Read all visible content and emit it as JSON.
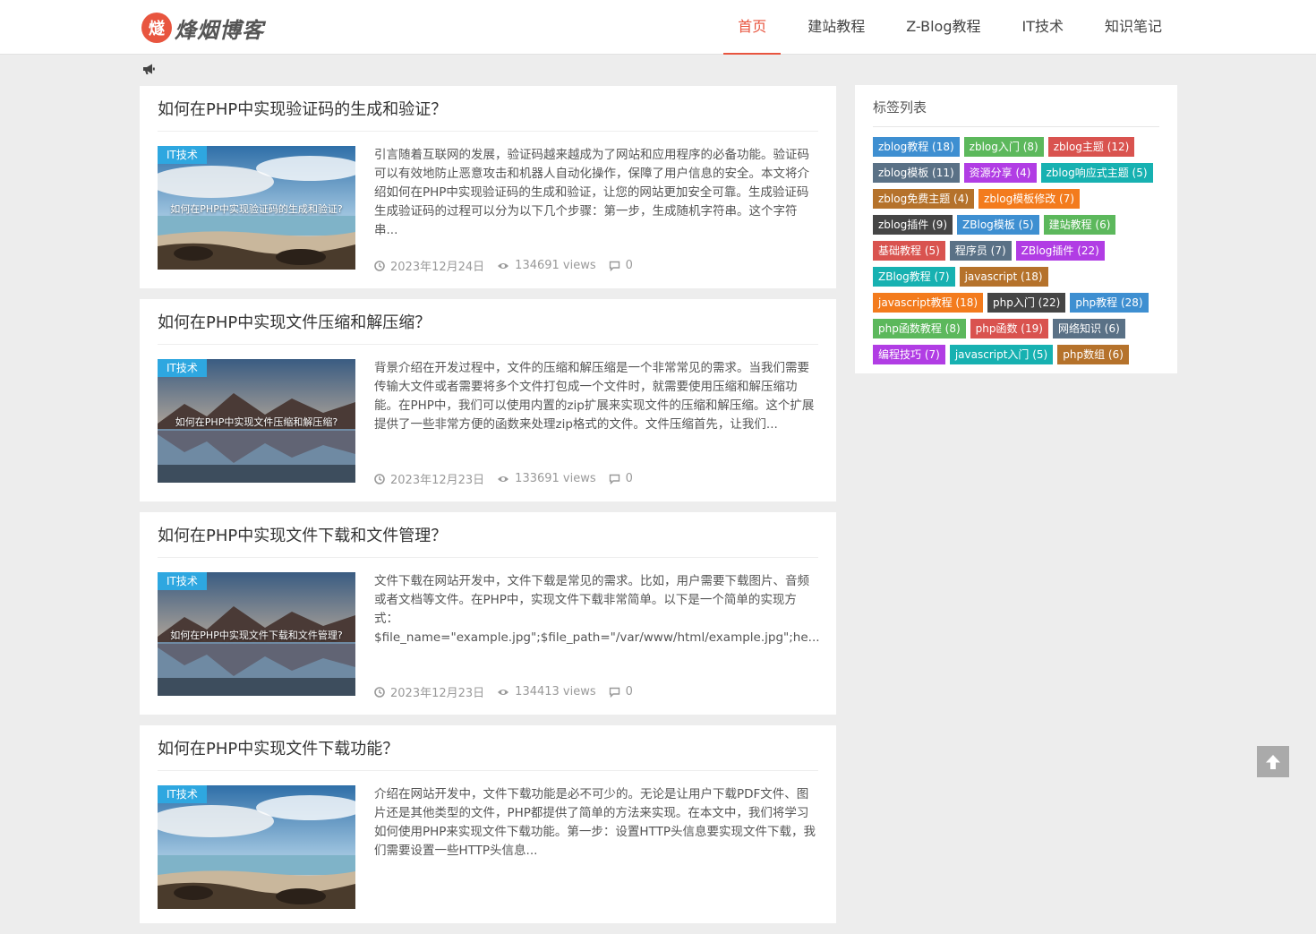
{
  "site": {
    "logo_badge": "燧",
    "logo_text": "烽烟博客"
  },
  "nav": [
    {
      "label": "首页",
      "active": true
    },
    {
      "label": "建站教程",
      "active": false
    },
    {
      "label": "Z-Blog教程",
      "active": false
    },
    {
      "label": "IT技术",
      "active": false
    },
    {
      "label": "知识笔记",
      "active": false
    }
  ],
  "notice_icon": "bullhorn-icon",
  "posts": [
    {
      "title": "如何在PHP中实现验证码的生成和验证？",
      "category": "IT技术",
      "thumb_text": "如何在PHP中实现验证码的生成和验证?",
      "excerpt": "引言随着互联网的发展，验证码越来越成为了网站和应用程序的必备功能。验证码可以有效地防止恶意攻击和机器人自动化操作，保障了用户信息的安全。本文将介绍如何在PHP中实现验证码的生成和验证，让您的网站更加安全可靠。生成验证码生成验证码的过程可以分为以下几个步骤：第一步，生成随机字符串。这个字符串...",
      "date": "2023年12月24日",
      "views": "134691 views",
      "comments": "0",
      "scene": "beach"
    },
    {
      "title": "如何在PHP中实现文件压缩和解压缩？",
      "category": "IT技术",
      "thumb_text": "如何在PHP中实现文件压缩和解压缩?",
      "excerpt": "背景介绍在开发过程中，文件的压缩和解压缩是一个非常常见的需求。当我们需要传输大文件或者需要将多个文件打包成一个文件时，就需要使用压缩和解压缩功能。在PHP中，我们可以使用内置的zip扩展来实现文件的压缩和解压缩。这个扩展提供了一些非常方便的函数来处理zip格式的文件。文件压缩首先，让我们...",
      "date": "2023年12月23日",
      "views": "133691 views",
      "comments": "0",
      "scene": "lake"
    },
    {
      "title": "如何在PHP中实现文件下载和文件管理？",
      "category": "IT技术",
      "thumb_text": "如何在PHP中实现文件下载和文件管理?",
      "excerpt": "文件下载在网站开发中，文件下载是常见的需求。比如，用户需要下载图片、音频或者文档等文件。在PHP中，实现文件下载非常简单。以下是一个简单的实现方式：$file_name=\"example.jpg\";$file_path=\"/var/www/html/example.jpg\";he...",
      "date": "2023年12月23日",
      "views": "134413 views",
      "comments": "0",
      "scene": "lake"
    },
    {
      "title": "如何在PHP中实现文件下载功能？",
      "category": "IT技术",
      "thumb_text": "",
      "excerpt": "介绍在网站开发中，文件下载功能是必不可少的。无论是让用户下载PDF文件、图片还是其他类型的文件，PHP都提供了简单的方法来实现。在本文中，我们将学习如何使用PHP来实现文件下载功能。第一步：设置HTTP头信息要实现文件下载，我们需要设置一些HTTP头信息...",
      "date": "",
      "views": "",
      "comments": "",
      "scene": "beach"
    }
  ],
  "sidebar": {
    "title": "标签列表",
    "tags": [
      {
        "label": "zblog教程 (18)",
        "color": "#3e8fd1"
      },
      {
        "label": "zblog入门 (8)",
        "color": "#5cb85c"
      },
      {
        "label": "zblog主题 (12)",
        "color": "#d9534f"
      },
      {
        "label": "zblog模板 (11)",
        "color": "#5a7186"
      },
      {
        "label": "资源分享 (4)",
        "color": "#b13de4"
      },
      {
        "label": "zblog响应式主题 (5)",
        "color": "#17b1b1"
      },
      {
        "label": "zblog免费主题 (4)",
        "color": "#b5722b"
      },
      {
        "label": "zblog模板修改 (7)",
        "color": "#f37b1d"
      },
      {
        "label": "zblog插件 (9)",
        "color": "#454545"
      },
      {
        "label": "ZBlog模板 (5)",
        "color": "#3e8fd1"
      },
      {
        "label": "建站教程 (6)",
        "color": "#5cb85c"
      },
      {
        "label": "基础教程 (5)",
        "color": "#d9534f"
      },
      {
        "label": "程序员 (7)",
        "color": "#5a7186"
      },
      {
        "label": "ZBlog插件 (22)",
        "color": "#b13de4"
      },
      {
        "label": "ZBlog教程 (7)",
        "color": "#17b1b1"
      },
      {
        "label": "javascript (18)",
        "color": "#b5722b"
      },
      {
        "label": "javascript教程 (18)",
        "color": "#f37b1d"
      },
      {
        "label": "php入门 (22)",
        "color": "#454545"
      },
      {
        "label": "php教程 (28)",
        "color": "#3e8fd1"
      },
      {
        "label": "php函数教程 (8)",
        "color": "#5cb85c"
      },
      {
        "label": "php函数 (19)",
        "color": "#d9534f"
      },
      {
        "label": "网络知识 (6)",
        "color": "#5a7186"
      },
      {
        "label": "编程技巧 (7)",
        "color": "#b13de4"
      },
      {
        "label": "javascript入门 (5)",
        "color": "#17b1b1"
      },
      {
        "label": "php数组 (6)",
        "color": "#b5722b"
      }
    ]
  },
  "back_to_top_icon": "arrow-up-icon"
}
